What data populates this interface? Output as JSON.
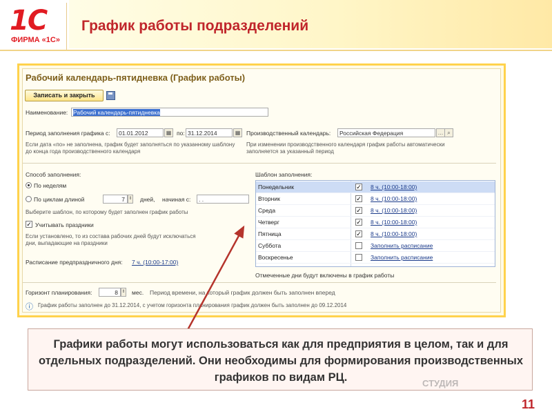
{
  "slide": {
    "logo_mark": "1C",
    "logo_text": "ФИРМА «1С»",
    "title": "График работы подразделений",
    "page_number": "11",
    "caption": "Графики работы могут использоваться как для предприятия в целом, так и для отдельных подразделений. Они необходимы для формирования производственных графиков по видам РЦ.",
    "watermark": "СТУДИЯ",
    "colors": {
      "brand_red": "#e11b22",
      "frame_yellow": "#ffd24c",
      "link_blue": "#1a3a8a"
    }
  },
  "form": {
    "title": "Рабочий календарь-пятидневка (График работы)",
    "save_close_label": "Записать и закрыть",
    "name_label": "Наименование:",
    "name_value": "Рабочий календарь-пятидневка",
    "period_label": "Период заполнения графика с:",
    "period_from": "01.01.2012",
    "period_to_label": "по:",
    "period_to": "31.12.2014",
    "period_hint": "Если дата «по» не заполнена, график будет заполняться по указанному шаблону до конца года производственного календаря",
    "prod_calendar_label": "Производственный календарь:",
    "prod_calendar_value": "Российская Федерация",
    "prod_calendar_hint": "При изменении производственного календаря график работы автоматически заполняется за указанный период",
    "fill_method_label": "Способ заполнения:",
    "by_weeks_label": "По неделям",
    "by_cycles_label": "По циклам длиной",
    "cycle_length": "7",
    "days_label": "дней,",
    "starting_label": "начиная с:",
    "starting_value": ". .",
    "template_hint": "Выберите шаблон, по которому будет заполнен график работы",
    "holidays_label": "Учитывать праздники",
    "holidays_hint": "Если установлено, то из состава рабочих дней будут исключаться дни, выпадающие на праздники",
    "preholiday_label": "Расписание предпраздничного дня:",
    "preholiday_value": "7 ч. (10:00-17:00)",
    "template_label": "Шаблон заполнения:",
    "template_rows": [
      {
        "day": "Понедельник",
        "checked": true,
        "schedule": "8 ч. (10:00-18:00)"
      },
      {
        "day": "Вторник",
        "checked": true,
        "schedule": "8 ч. (10:00-18:00)"
      },
      {
        "day": "Среда",
        "checked": true,
        "schedule": "8 ч. (10:00-18:00)"
      },
      {
        "day": "Четверг",
        "checked": true,
        "schedule": "8 ч. (10:00-18:00)"
      },
      {
        "day": "Пятница",
        "checked": true,
        "schedule": "8 ч. (10:00-18:00)"
      },
      {
        "day": "Суббота",
        "checked": false,
        "schedule": "Заполнить расписание"
      },
      {
        "day": "Воскресенье",
        "checked": false,
        "schedule": "Заполнить расписание"
      }
    ],
    "template_footer": "Отмеченные дни будут включены в график работы",
    "horizon_label": "Горизонт планирования:",
    "horizon_value": "8",
    "horizon_unit": "мес.",
    "horizon_hint": "Период времени, на который график должен быть заполнен вперед",
    "status_text": "График работы заполнен до 31.12.2014, с учетом горизонта планирования график должен быть заполнен до 09.12.2014"
  }
}
